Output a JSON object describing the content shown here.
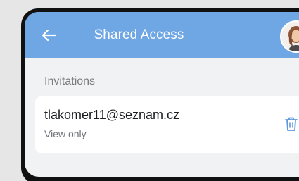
{
  "header": {
    "title": "Shared Access",
    "back_icon": "arrow-left-icon",
    "avatar_icon": "user-avatar",
    "bg_color": "#6fa6e4"
  },
  "invitations": {
    "section_label": "Invitations",
    "items": [
      {
        "email": "tlakomer11@seznam.cz",
        "permission": "View only",
        "action_icon": "trash-icon"
      }
    ]
  },
  "colors": {
    "accent": "#6fa6e4",
    "background": "#f1f2f3",
    "card": "#ffffff"
  }
}
